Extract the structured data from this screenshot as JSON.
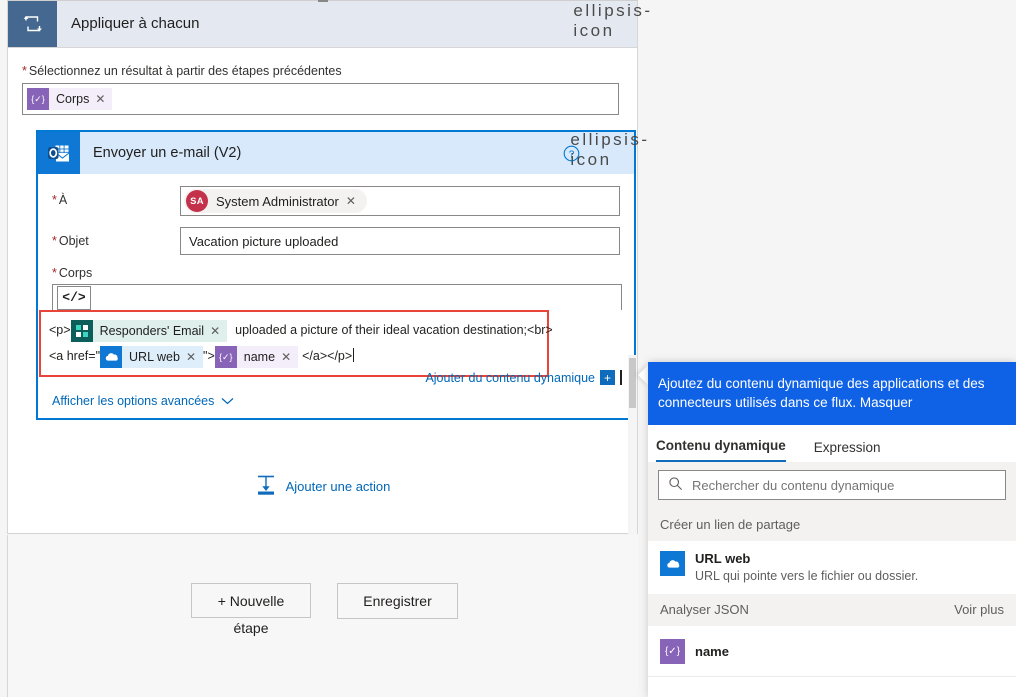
{
  "scope": {
    "title": "Appliquer à chacun",
    "icon": "loop-icon",
    "more_icon": "ellipsis-icon",
    "input_label": "Sélectionnez un résultat à partir des étapes précédentes",
    "required_marker": "*",
    "token": {
      "label": "Corps",
      "icon_glyph": "{✓}",
      "remove": "✕",
      "kind": "expression"
    }
  },
  "email_action": {
    "title": "Envoyer un e-mail (V2)",
    "icon": "outlook-icon",
    "help_icon": "?",
    "more_icon": "ellipsis-icon",
    "to": {
      "label": "À",
      "chip": {
        "initials": "SA",
        "name": "System Administrator",
        "remove": "✕"
      }
    },
    "subject": {
      "label": "Objet",
      "value": "Vacation picture uploaded"
    },
    "body": {
      "label": "Corps",
      "code_toggle": "</>",
      "line1": {
        "prefix": "<p>",
        "token": {
          "label": "Responders' Email",
          "icon_glyph": "▦",
          "remove": "✕",
          "kind": "forms"
        },
        "suffix": "uploaded a picture of their ideal vacation destination;<br>"
      },
      "line2": {
        "prefix": "<a href=\"",
        "token1": {
          "label": "URL web",
          "icon_glyph": "☁",
          "remove": "✕",
          "kind": "onedrive"
        },
        "mid": "\">",
        "token2": {
          "label": "name",
          "icon_glyph": "{✓}",
          "remove": "✕",
          "kind": "expression"
        },
        "suffix": "</a></p>"
      }
    },
    "add_dynamic_content": "Ajouter du contenu dynamique",
    "add_dynamic_plus": "+",
    "advanced_options": "Afficher les options avancées",
    "advanced_chevron": "⌄"
  },
  "add_action": {
    "label": "Ajouter une action",
    "icon": "insert-below-icon"
  },
  "command_bar": {
    "new_step_line1": "+ Nouvelle",
    "new_step_line2": "étape",
    "save": "Enregistrer"
  },
  "dynamic_panel": {
    "banner_text": "Ajoutez du contenu dynamique des applications et des connecteurs utilisés dans ce flux.",
    "hide_label": "Masquer",
    "tabs": [
      {
        "label": "Contenu dynamique",
        "active": true
      },
      {
        "label": "Expression",
        "active": false
      }
    ],
    "search": {
      "placeholder": "Rechercher du contenu dynamique",
      "icon": "search-icon",
      "value": ""
    },
    "groups": [
      {
        "name": "Créer un lien de partage",
        "see_more": "",
        "items": [
          {
            "title": "URL web",
            "description": "URL qui pointe vers le fichier ou dossier.",
            "icon": "onedrive-icon",
            "kind": "onedrive"
          }
        ]
      },
      {
        "name": "Analyser JSON",
        "see_more": "Voir plus",
        "items": [
          {
            "title": "name",
            "description": "",
            "icon": "expression-icon",
            "kind": "expression"
          }
        ]
      }
    ]
  },
  "colors": {
    "accent_blue": "#0078d4",
    "banner_blue": "#0f62e6",
    "scope_header_bg": "#e4e9f1",
    "scope_icon_bg": "#44688f",
    "email_header_bg": "#d7e9fa",
    "error_red": "#e8443a",
    "required_red": "#a4262c",
    "link_blue": "#0067b8",
    "avatar_red": "#c4314b",
    "token_expression": "#8764b8",
    "token_forms": "#0c5e5b",
    "token_onedrive": "#0f78d4",
    "page_bg": "#f5f5f5"
  }
}
